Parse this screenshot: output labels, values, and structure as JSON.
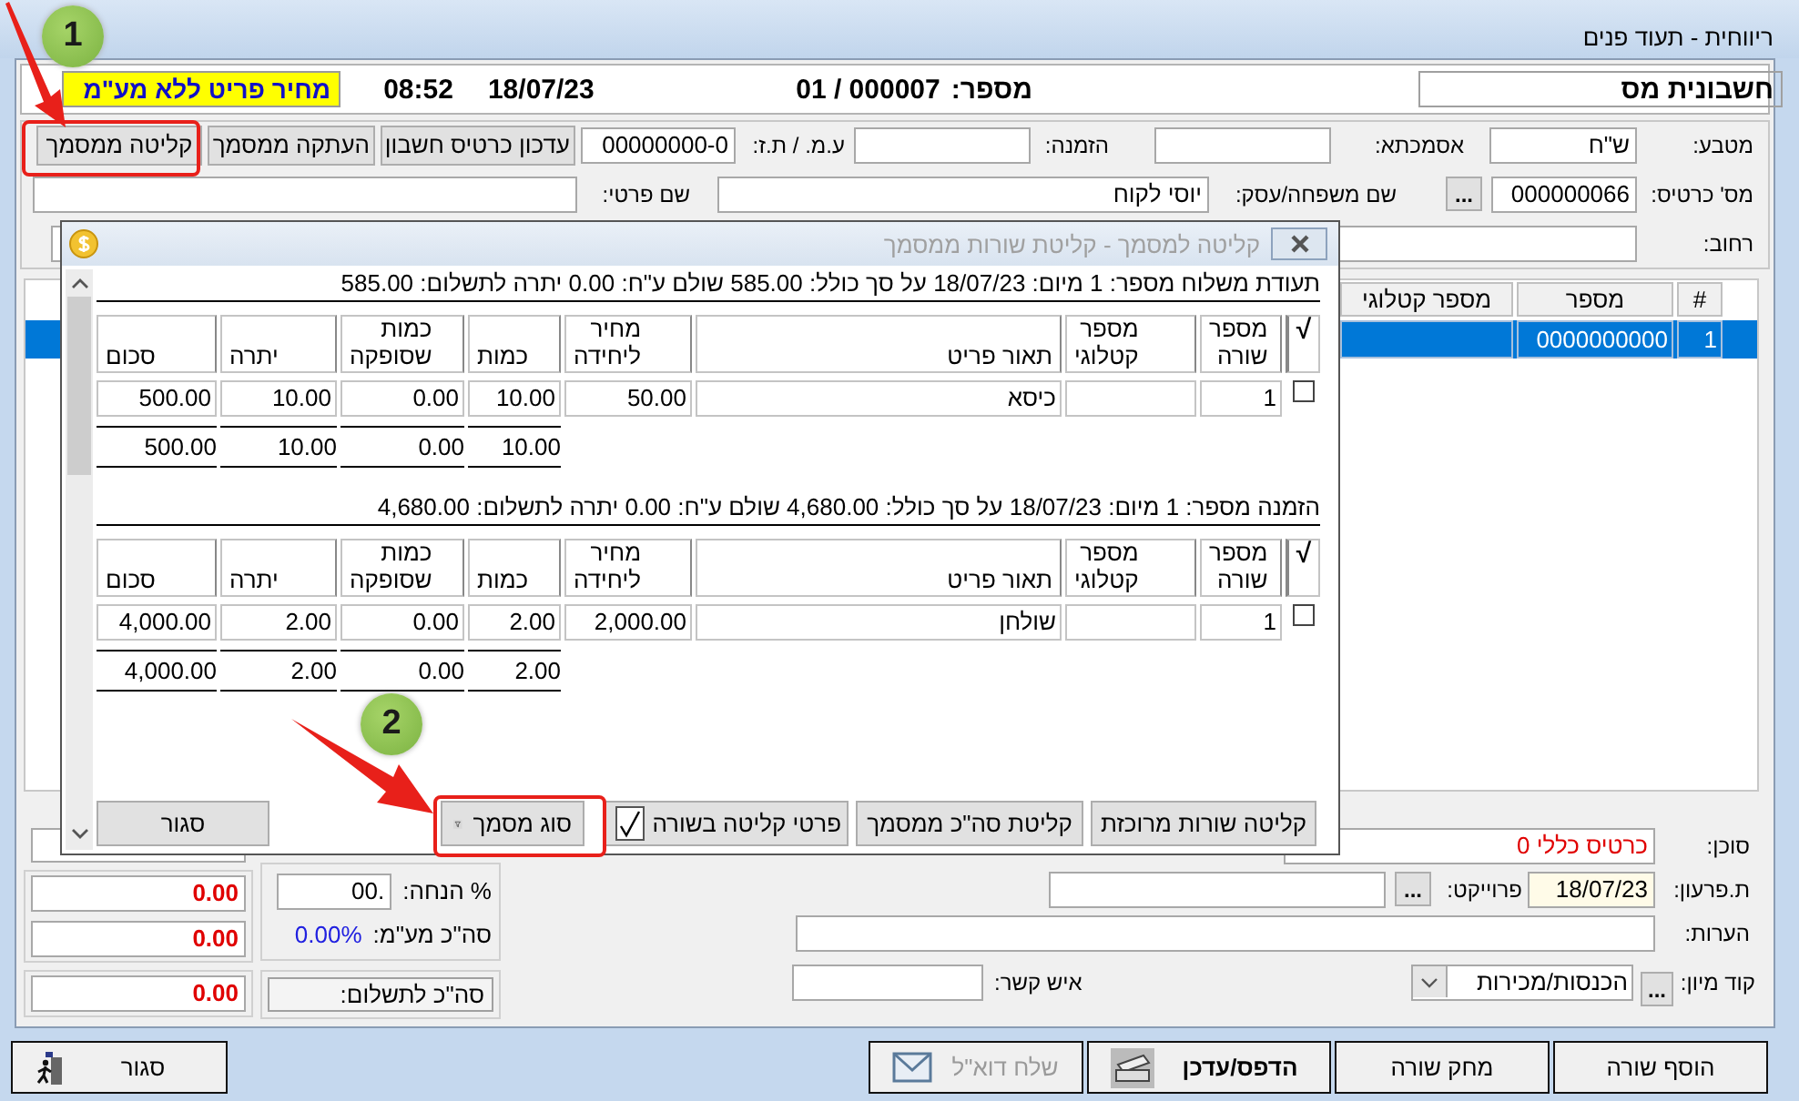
{
  "window": {
    "title": "ריווחית - תעוד פנים"
  },
  "header": {
    "doc_type": "חשבונית מס",
    "number_label": "מספר:",
    "number": "01 / 000007",
    "date": "18/07/23",
    "time": "08:52",
    "price_mode": "מחיר פריט ללא מע\"מ"
  },
  "form": {
    "currency_label": "מטבע:",
    "currency": "ש\"ח",
    "reference_label": "אסמכתא:",
    "order_label": "הזמנה:",
    "tax_id_label": "ע.מ. / ת.ז:",
    "tax_id": "00000000-0",
    "buttons": [
      "עדכון כרטיס חשבון",
      "העתקה ממסמך",
      "קליטה ממסמך"
    ],
    "card_label": "מס' כרטיס:",
    "card": "000000066",
    "browse": "...",
    "family_label": "שם משפחה/עסק:",
    "family": "יוסי לקוח",
    "first_name_label": "שם פרטי:",
    "street_label": "רחוב:"
  },
  "grid": {
    "columns": [
      "#",
      "מספר",
      "מספר קטלוגי"
    ],
    "rows": [
      {
        "selected": true,
        "cells": [
          "1",
          "0000000000"
        ]
      }
    ]
  },
  "bottom_form": {
    "agent_label": "סוכן:",
    "agent": "כרטיס כללי 0",
    "due_label": "ת.פרעון:",
    "due": "18/07/23",
    "project_label": "פרוייקט:",
    "project_browse": "...",
    "notes_label": "הערות:",
    "sort_label": "קוד מיון:",
    "sort_browse": "...",
    "sort": "הכנסות/מכירות",
    "contact_label": "איש קשר:",
    "discount_label": "% הנחה:",
    "discount": ".00",
    "vat_label": "סה\"כ מע\"מ:",
    "vat": "0.00%",
    "total_label": "סה\"כ לתשלום:",
    "amounts": [
      "0.00",
      "0.00",
      "0.00"
    ]
  },
  "buttons": [
    {
      "label": "הוסף שורה",
      "kind": "plain",
      "disabled": false
    },
    {
      "label": "מחק שורה",
      "kind": "plain",
      "disabled": false
    },
    {
      "label": "הדפס/עדכן",
      "kind": "print",
      "disabled": false
    },
    {
      "label": "שלח דוא\"ל",
      "kind": "email",
      "disabled": true
    },
    {
      "label": "סגור",
      "kind": "close",
      "disabled": false
    }
  ],
  "dialog": {
    "title": "קליטה למסמך - קליטת שורות ממסמך",
    "documents": [
      {
        "title": "תעודת משלוח  מספר: 1 מיום: 18/07/23 על סך כולל: 585.00 שולם ע\"ח: 0.00 יתרה לתשלום: 585.00",
        "columns": [
          "√",
          "מספר שורה",
          "מספר קטלוגי",
          "תאור פריט",
          "מחיר ליחידה",
          "כמות",
          "כמות שסופקה",
          "יתרה",
          "סכום"
        ],
        "rows": [
          {
            "checked": false,
            "line": "1",
            "description": "כיסא",
            "unit_price": "50.00",
            "qty": "10.00",
            "supplied": "0.00",
            "balance": "10.00",
            "amount": "500.00"
          }
        ],
        "totals": {
          "qty": "10.00",
          "supplied": "0.00",
          "balance": "10.00",
          "amount": "500.00"
        }
      },
      {
        "title": "הזמנה מספר: 1 מיום: 18/07/23 על סך כולל: 4,680.00 שולם ע\"ח: 0.00 יתרה לתשלום: 4,680.00",
        "columns": [
          "√",
          "מספר שורה",
          "מספר קטלוגי",
          "תאור פריט",
          "מחיר ליחידה",
          "כמות",
          "כמות שסופקה",
          "יתרה",
          "סכום"
        ],
        "rows": [
          {
            "checked": false,
            "line": "1",
            "description": "שולחן",
            "unit_price": "2,000.00",
            "qty": "2.00",
            "supplied": "0.00",
            "balance": "2.00",
            "amount": "4,000.00"
          }
        ],
        "totals": {
          "qty": "2.00",
          "supplied": "0.00",
          "balance": "2.00",
          "amount": "4,000.00"
        }
      }
    ],
    "actions": {
      "bulk": "קליטה שורות מרוכזת",
      "total": "קליטת סה\"כ ממסמך",
      "details_label": "פרטי קליטה בשורה",
      "details_checked": true,
      "doc_type": "סוג מסמך",
      "close": "סגור"
    }
  },
  "annotations": [
    {
      "number": "1"
    },
    {
      "number": "2"
    }
  ]
}
